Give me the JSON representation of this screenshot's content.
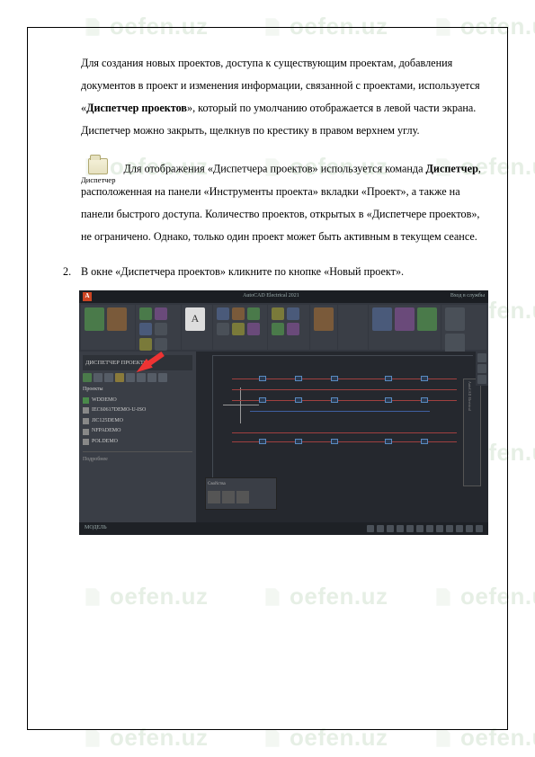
{
  "watermark": "oefen.uz",
  "para1": {
    "t1": "Для создания новых проектов, доступа к существующим проектам, добавления документов в проект и изменения информации, связанной с проектами, используется «",
    "b1": "Диспетчер проектов",
    "t2": "», который по умолчанию отображается в левой части экрана. Диспетчер можно закрыть, щелкнув по крестику в правом верхнем углу."
  },
  "iconLabel": "Диспетчер",
  "para2": {
    "t1": " Для отображения «Диспетчера проектов» используется команда ",
    "b1": "Диспетчер",
    "t2": ", расположенная на панели «Инструменты проекта» вкладки «Проект», а также на панели быстрого доступа. Количество проектов, открытых в «Диспетчере проектов», не ограничено. Однако, только один проект может быть активным в текущем сеансе."
  },
  "list2": {
    "num": "2.",
    "text": "В окне «Диспетчера проектов» кликните по кнопке «Новый проект»."
  },
  "screenshot": {
    "titleCenter": "AutoCAD Electrical 2021",
    "titleRight": "Вход в службы",
    "sidebar": {
      "header": "ДИСПЕТЧЕР ПРОЕКТОВ",
      "section1": "Проекты",
      "items": [
        "WDDEMO",
        "IEC60617DEMO-U-ISO",
        "JIC125DEMO",
        "NFPADEMO",
        "POLDEMO"
      ],
      "section2": "Подробнее"
    },
    "palette": "Свойства",
    "statusLeft": "МОДЕЛЬ"
  }
}
